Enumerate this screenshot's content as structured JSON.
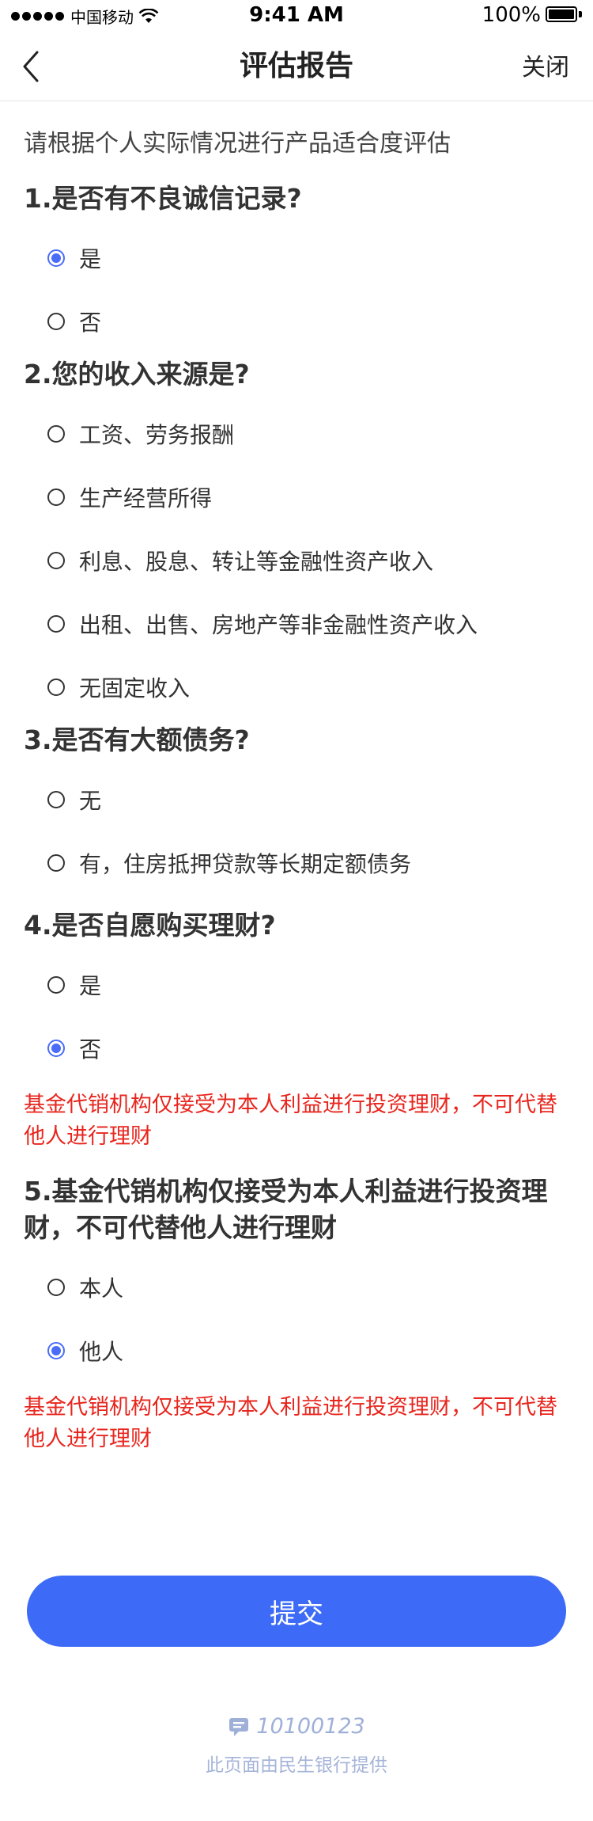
{
  "status_bar": {
    "carrier": "中国移动",
    "time": "9:41 AM",
    "battery": "100%"
  },
  "nav": {
    "title": "评估报告",
    "close_label": "关闭"
  },
  "intro": "请根据个人实际情况进行产品适合度评估",
  "questions": [
    {
      "title": "1.是否有不良诚信记录?",
      "options": [
        {
          "label": "是",
          "checked": true
        },
        {
          "label": "否",
          "checked": false
        }
      ]
    },
    {
      "title": "2.您的收入来源是?",
      "options": [
        {
          "label": "工资、劳务报酬",
          "checked": false
        },
        {
          "label": "生产经营所得",
          "checked": false
        },
        {
          "label": "利息、股息、转让等金融性资产收入",
          "checked": false
        },
        {
          "label": "出租、出售、房地产等非金融性资产收入",
          "checked": false
        },
        {
          "label": "无固定收入",
          "checked": false
        }
      ]
    },
    {
      "title": "3.是否有大额债务?",
      "options": [
        {
          "label": "无",
          "checked": false
        },
        {
          "label": "有，住房抵押贷款等长期定额债务",
          "checked": false
        }
      ]
    },
    {
      "title": "4.是否自愿购买理财?",
      "options": [
        {
          "label": "是",
          "checked": false
        },
        {
          "label": "否",
          "checked": true
        }
      ],
      "warning": "基金代销机构仅接受为本人利益进行投资理财，不可代替他人进行理财"
    },
    {
      "title": "5.基金代销机构仅接受为本人利益进行投资理财，不可代替他人进行理财",
      "options": [
        {
          "label": "本人",
          "checked": false
        },
        {
          "label": "他人",
          "checked": true
        }
      ],
      "warning": "基金代销机构仅接受为本人利益进行投资理财，不可代替他人进行理财"
    }
  ],
  "submit_label": "提交",
  "footer": {
    "code": "10100123",
    "note": "此页面由民生银行提供"
  },
  "colors": {
    "accent": "#3d6bf7",
    "warning": "#e8261e",
    "footer": "#9fb0d8"
  }
}
